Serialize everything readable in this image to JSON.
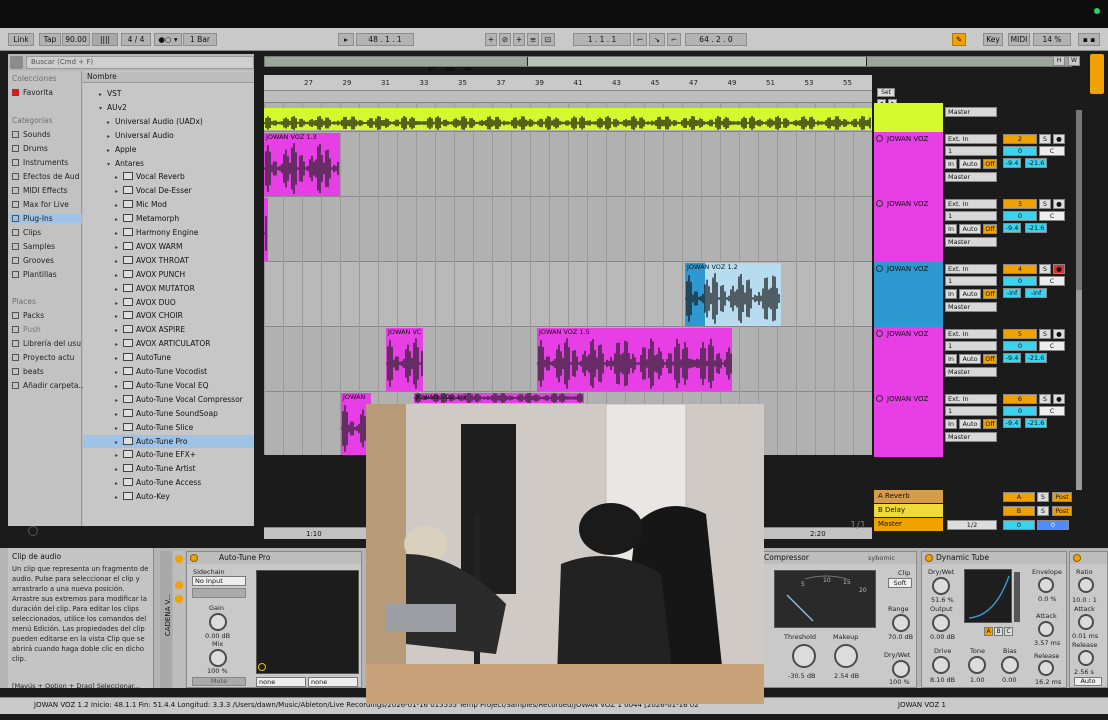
{
  "transport": {
    "link": "Link",
    "tap": "Tap",
    "tempo": "90.00",
    "meter": "4 / 4",
    "quantize": "1 Bar",
    "position": "48 .   1 .   1",
    "loop_start": "1 .   1 .   1",
    "loop_length": "64 .   2 .   0",
    "key": "Key",
    "midi": "MIDI",
    "cpu": "14 %"
  },
  "browser": {
    "search_placeholder": "Buscar (Cmd + F)",
    "collections_header": "Colecciones",
    "favorites": "Favorita",
    "categories_header": "Categorías",
    "categories": [
      "Sounds",
      "Drums",
      "Instruments",
      "Efectos de Aud",
      "MIDI Effects",
      "Max for Live",
      "Plug-Ins",
      "Clips",
      "Samples",
      "Grooves",
      "Plantillas"
    ],
    "places_header": "Places",
    "places": [
      "Packs",
      "Push",
      "Librería del usu",
      "Proyecto actu",
      "beats",
      "Añadir carpeta..."
    ],
    "name_header": "Nombre",
    "items": [
      "VST",
      "AUv2",
      "Universal Audio (UADx)",
      "Universal Audio",
      "Apple",
      "Antares",
      "Vocal Reverb",
      "Vocal De-Esser",
      "Mic Mod",
      "Metamorph",
      "Harmony Engine",
      "AVOX WARM",
      "AVOX THROAT",
      "AVOX PUNCH",
      "AVOX MUTATOR",
      "AVOX DUO",
      "AVOX CHOIR",
      "AVOX ASPIRE",
      "AVOX ARTICULATOR",
      "AutoTune",
      "Auto-Tune Vocodist",
      "Auto-Tune Vocal EQ",
      "Auto-Tune Vocal Compressor",
      "Auto-Tune SoundSoap",
      "Auto-Tune Slice",
      "Auto-Tune Pro",
      "Auto-Tune EFX+",
      "Auto-Tune Artist",
      "Auto-Tune Access",
      "Auto-Key"
    ]
  },
  "ruler": {
    "bars": [
      "27",
      "29",
      "31",
      "33",
      "35",
      "37",
      "39",
      "41",
      "43",
      "45",
      "47",
      "49",
      "51",
      "53",
      "55"
    ],
    "times": [
      "1:10",
      "2:20"
    ],
    "page": "1/1"
  },
  "set_button": "Set",
  "clips": [
    "JOWAN VOZ 1.3",
    "JOWAN VOZ 1.2",
    "JOWAN VC",
    "JOWAN VOZ 1.5",
    "JOWAN",
    "JOWAN VOZ 1.7"
  ],
  "tracks": [
    {
      "name": "",
      "input": "",
      "channel": "",
      "monitor": [
        "",
        "",
        ""
      ],
      "output": "Master",
      "num": "",
      "vol": "",
      "pan": ""
    },
    {
      "name": "JOWAN VOZ",
      "input": "Ext. In",
      "channel": "1",
      "monitor": [
        "In",
        "Auto",
        "Off"
      ],
      "output": "Master",
      "num": "2",
      "vol": "0",
      "pan": "C",
      "sends": [
        "-9.4",
        "-21.6"
      ]
    },
    {
      "name": "JOWAN VOZ",
      "input": "Ext. In",
      "channel": "1",
      "monitor": [
        "In",
        "Auto",
        "Off"
      ],
      "output": "Master",
      "num": "3",
      "vol": "0",
      "pan": "C",
      "sends": [
        "-9.4",
        "-21.6"
      ]
    },
    {
      "name": "JOWAN VOZ",
      "input": "Ext. In",
      "channel": "1",
      "monitor": [
        "In",
        "Auto",
        "Off"
      ],
      "output": "Master",
      "num": "4",
      "vol": "0",
      "pan": "C",
      "sends": [
        "-inf",
        "-inf"
      ]
    },
    {
      "name": "JOWAN VOZ",
      "input": "Ext. In",
      "channel": "1",
      "monitor": [
        "In",
        "Auto",
        "Off"
      ],
      "output": "Master",
      "num": "5",
      "vol": "0",
      "pan": "C",
      "sends": [
        "-9.4",
        "-21.6"
      ]
    },
    {
      "name": "JOWAN VOZ",
      "input": "Ext. In",
      "channel": "1",
      "monitor": [
        "In",
        "Auto",
        "Off"
      ],
      "output": "Master",
      "num": "6",
      "vol": "0",
      "pan": "C",
      "sends": [
        "-9.4",
        "-21.6"
      ]
    }
  ],
  "returns": [
    {
      "name": "A Reverb",
      "letter": "A",
      "solo": "S",
      "post": "Post"
    },
    {
      "name": "B Delay",
      "letter": "B",
      "solo": "S",
      "post": "Post"
    },
    {
      "name": "Master",
      "letter": "0",
      "solo": "0",
      "post": "1/2"
    }
  ],
  "info": {
    "title": "Clip de audio",
    "body": "Un clip que representa un fragmento de audio. Pulse para seleccionar el clip y arrastrarlo a una nueva posición. Arrastre sus extremos para modificar la duración del clip. Para editar los clips seleccionados, utilice los comandos del menú Edición. Las propiedades del clip pueden editarse en la vista Clip que se abrirá cuando haga doble clic en dicho clip.",
    "hint": "[Mayús + Option + Drag] Seleccionar..."
  },
  "devices": {
    "chain": "CADENA V...",
    "autotune": {
      "title": "Auto-Tune Pro",
      "sidechain": "Sidechain",
      "input": "No Input",
      "gain": "Gain",
      "gain_val": "0.00 dB",
      "mix": "Mix",
      "mix_val": "100 %",
      "mute": "Mute",
      "sel1": "none",
      "sel2": "none"
    },
    "compressor": {
      "title": "Compressor",
      "brand": "sybomic",
      "threshold": "Threshold",
      "threshold_val": "-30.5 dB",
      "makeup": "Makeup",
      "makeup_val": "2.54 dB",
      "clip": "Clip",
      "soft": "Soft",
      "range": "Range",
      "range_val": "70.0 dB",
      "drywet": "Dry/Wet",
      "drywet_val": "100 %",
      "scale": [
        "5",
        "10",
        "15",
        "20"
      ]
    },
    "tube": {
      "title": "Dynamic Tube",
      "drywet": "Dry/Wet",
      "drywet_val": "51.6 %",
      "output": "Output",
      "output_val": "0.00 dB",
      "drive": "Drive",
      "drive_val": "8.10 dB",
      "tone": "Tone",
      "tone_val": "1.00",
      "bias": "Bias",
      "bias_val": "0.00",
      "envelope": "Envelope",
      "envelope_val": "0.0 %",
      "attack": "Attack",
      "attack_val": "3.57 ms",
      "release": "Release",
      "release_val": "16.2 ms",
      "abc": [
        "A",
        "B",
        "C"
      ]
    },
    "ratio": {
      "ratio": "Ratio",
      "ratio_val": "10.0 : 1",
      "attack": "Attack",
      "attack_val": "0.01 ms",
      "release": "Release",
      "release_val": "2.56 s",
      "auto": "Auto"
    }
  },
  "status": {
    "text": "JOWAN VOZ 1.2  Inicio: 48.1.1  Fin: 51.4.4  Longitud: 3.3.3  /Users/dawn/Music/Ableton/Live Recordings/2026-01-16 015555 Temp Project/Samples/Recorded/JOWAN VOZ 1 0044 [2026-01-16 02",
    "track": "JOWAN VOZ 1"
  },
  "colors": {
    "magenta": "#e83ee6",
    "lime": "#d4f92d",
    "blue": "#2e98d0",
    "orange": "#f0a300",
    "selected": "#9fc3e6"
  }
}
